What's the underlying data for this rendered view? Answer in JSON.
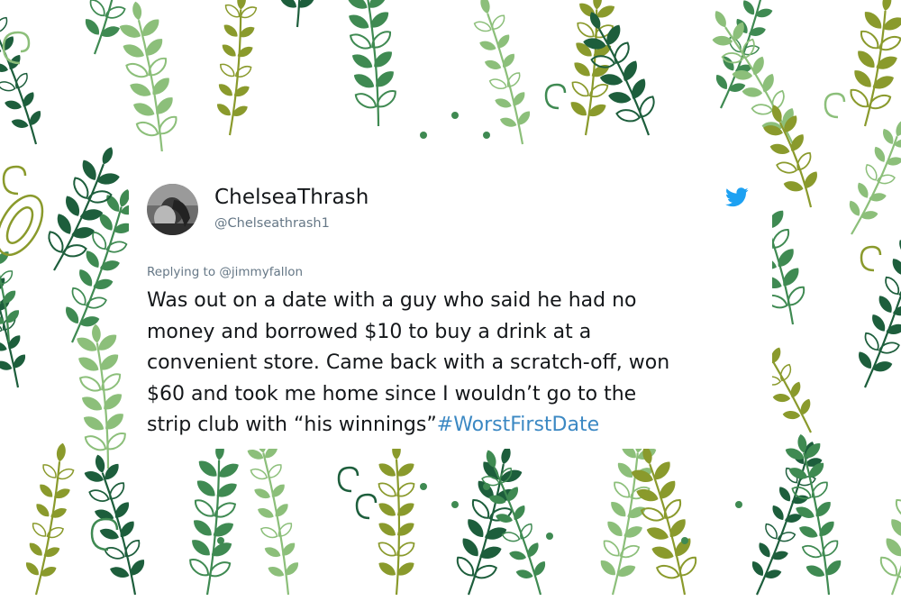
{
  "tweet": {
    "display_name": "ChelseaThrash",
    "handle": "@Chelseathrash1",
    "reply_to": "Replying to @jimmyfallon",
    "lines": [
      "Was out on a date with a guy who said he had no",
      "money and borrowed $10 to buy a drink at a",
      "convenient store. Came back with a scratch-off, won",
      "$60 and took me home since I wouldn’t go to the",
      "strip club with “his winnings”"
    ],
    "hashtag": "#WorstFirstDate"
  },
  "colors": {
    "hashtag": "#3b88c3",
    "twitter_blue": "#1da1f2",
    "leaf_dark": "#1d5e3c",
    "leaf_mid": "#3f8a52",
    "leaf_light": "#8cbf7a",
    "leaf_olive": "#8a9a2c"
  },
  "icons": [
    "twitter-bird-icon",
    "avatar-photo"
  ]
}
